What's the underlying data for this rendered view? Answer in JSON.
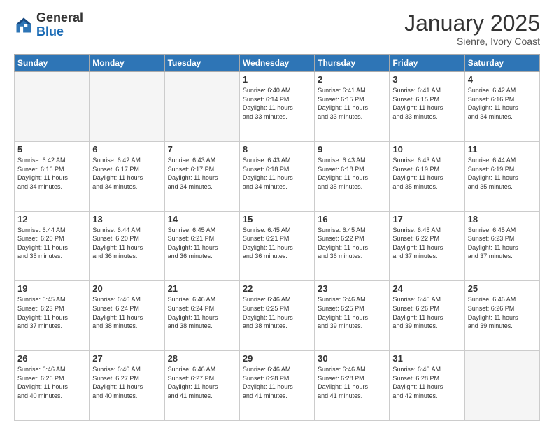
{
  "header": {
    "logo_general": "General",
    "logo_blue": "Blue",
    "month_title": "January 2025",
    "subtitle": "Sienre, Ivory Coast"
  },
  "days_of_week": [
    "Sunday",
    "Monday",
    "Tuesday",
    "Wednesday",
    "Thursday",
    "Friday",
    "Saturday"
  ],
  "weeks": [
    [
      {
        "day": "",
        "info": ""
      },
      {
        "day": "",
        "info": ""
      },
      {
        "day": "",
        "info": ""
      },
      {
        "day": "1",
        "info": "Sunrise: 6:40 AM\nSunset: 6:14 PM\nDaylight: 11 hours\nand 33 minutes."
      },
      {
        "day": "2",
        "info": "Sunrise: 6:41 AM\nSunset: 6:15 PM\nDaylight: 11 hours\nand 33 minutes."
      },
      {
        "day": "3",
        "info": "Sunrise: 6:41 AM\nSunset: 6:15 PM\nDaylight: 11 hours\nand 33 minutes."
      },
      {
        "day": "4",
        "info": "Sunrise: 6:42 AM\nSunset: 6:16 PM\nDaylight: 11 hours\nand 34 minutes."
      }
    ],
    [
      {
        "day": "5",
        "info": "Sunrise: 6:42 AM\nSunset: 6:16 PM\nDaylight: 11 hours\nand 34 minutes."
      },
      {
        "day": "6",
        "info": "Sunrise: 6:42 AM\nSunset: 6:17 PM\nDaylight: 11 hours\nand 34 minutes."
      },
      {
        "day": "7",
        "info": "Sunrise: 6:43 AM\nSunset: 6:17 PM\nDaylight: 11 hours\nand 34 minutes."
      },
      {
        "day": "8",
        "info": "Sunrise: 6:43 AM\nSunset: 6:18 PM\nDaylight: 11 hours\nand 34 minutes."
      },
      {
        "day": "9",
        "info": "Sunrise: 6:43 AM\nSunset: 6:18 PM\nDaylight: 11 hours\nand 35 minutes."
      },
      {
        "day": "10",
        "info": "Sunrise: 6:43 AM\nSunset: 6:19 PM\nDaylight: 11 hours\nand 35 minutes."
      },
      {
        "day": "11",
        "info": "Sunrise: 6:44 AM\nSunset: 6:19 PM\nDaylight: 11 hours\nand 35 minutes."
      }
    ],
    [
      {
        "day": "12",
        "info": "Sunrise: 6:44 AM\nSunset: 6:20 PM\nDaylight: 11 hours\nand 35 minutes."
      },
      {
        "day": "13",
        "info": "Sunrise: 6:44 AM\nSunset: 6:20 PM\nDaylight: 11 hours\nand 36 minutes."
      },
      {
        "day": "14",
        "info": "Sunrise: 6:45 AM\nSunset: 6:21 PM\nDaylight: 11 hours\nand 36 minutes."
      },
      {
        "day": "15",
        "info": "Sunrise: 6:45 AM\nSunset: 6:21 PM\nDaylight: 11 hours\nand 36 minutes."
      },
      {
        "day": "16",
        "info": "Sunrise: 6:45 AM\nSunset: 6:22 PM\nDaylight: 11 hours\nand 36 minutes."
      },
      {
        "day": "17",
        "info": "Sunrise: 6:45 AM\nSunset: 6:22 PM\nDaylight: 11 hours\nand 37 minutes."
      },
      {
        "day": "18",
        "info": "Sunrise: 6:45 AM\nSunset: 6:23 PM\nDaylight: 11 hours\nand 37 minutes."
      }
    ],
    [
      {
        "day": "19",
        "info": "Sunrise: 6:45 AM\nSunset: 6:23 PM\nDaylight: 11 hours\nand 37 minutes."
      },
      {
        "day": "20",
        "info": "Sunrise: 6:46 AM\nSunset: 6:24 PM\nDaylight: 11 hours\nand 38 minutes."
      },
      {
        "day": "21",
        "info": "Sunrise: 6:46 AM\nSunset: 6:24 PM\nDaylight: 11 hours\nand 38 minutes."
      },
      {
        "day": "22",
        "info": "Sunrise: 6:46 AM\nSunset: 6:25 PM\nDaylight: 11 hours\nand 38 minutes."
      },
      {
        "day": "23",
        "info": "Sunrise: 6:46 AM\nSunset: 6:25 PM\nDaylight: 11 hours\nand 39 minutes."
      },
      {
        "day": "24",
        "info": "Sunrise: 6:46 AM\nSunset: 6:26 PM\nDaylight: 11 hours\nand 39 minutes."
      },
      {
        "day": "25",
        "info": "Sunrise: 6:46 AM\nSunset: 6:26 PM\nDaylight: 11 hours\nand 39 minutes."
      }
    ],
    [
      {
        "day": "26",
        "info": "Sunrise: 6:46 AM\nSunset: 6:26 PM\nDaylight: 11 hours\nand 40 minutes."
      },
      {
        "day": "27",
        "info": "Sunrise: 6:46 AM\nSunset: 6:27 PM\nDaylight: 11 hours\nand 40 minutes."
      },
      {
        "day": "28",
        "info": "Sunrise: 6:46 AM\nSunset: 6:27 PM\nDaylight: 11 hours\nand 41 minutes."
      },
      {
        "day": "29",
        "info": "Sunrise: 6:46 AM\nSunset: 6:28 PM\nDaylight: 11 hours\nand 41 minutes."
      },
      {
        "day": "30",
        "info": "Sunrise: 6:46 AM\nSunset: 6:28 PM\nDaylight: 11 hours\nand 41 minutes."
      },
      {
        "day": "31",
        "info": "Sunrise: 6:46 AM\nSunset: 6:28 PM\nDaylight: 11 hours\nand 42 minutes."
      },
      {
        "day": "",
        "info": ""
      }
    ]
  ]
}
